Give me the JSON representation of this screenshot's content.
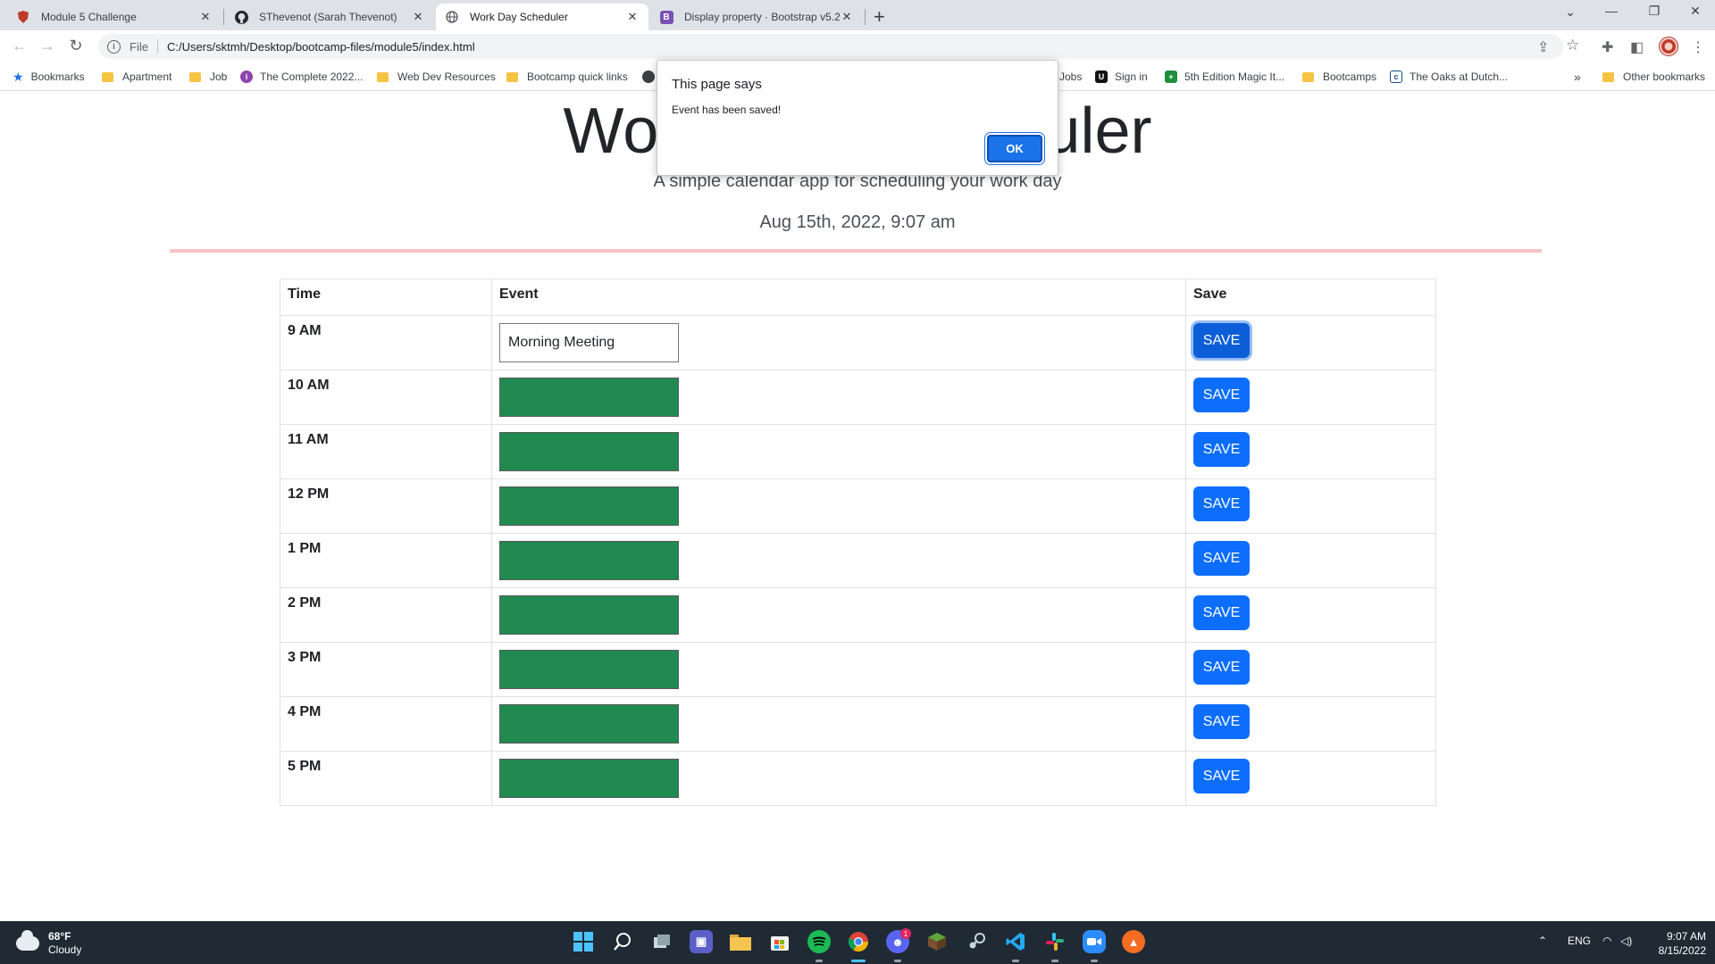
{
  "browser": {
    "tabs": [
      {
        "title": "Module 5 Challenge",
        "icon": "shield-favicon"
      },
      {
        "title": "SThevenot (Sarah Thevenot)",
        "icon": "github-favicon"
      },
      {
        "title": "Work Day Scheduler",
        "icon": "globe-favicon",
        "active": true
      },
      {
        "title": "Display property · Bootstrap v5.2",
        "icon": "bootstrap-favicon"
      }
    ],
    "address": {
      "scheme_label": "File",
      "url": "C:/Users/sktmh/Desktop/bootcamp-files/module5/index.html"
    },
    "bookmarks": [
      "Bookmarks",
      "Apartment",
      "Job",
      "The Complete 2022...",
      "Web Dev Resources",
      "Bootcamp quick links",
      "Jobs",
      "Sign in",
      "5th Edition Magic It...",
      "Bootcamps",
      "The Oaks at Dutch...",
      "Other bookmarks"
    ],
    "bookmarks_overflow": "»"
  },
  "page": {
    "title": "Work Day Scheduler",
    "lead": "A simple calendar app for scheduling your work day",
    "current_day": "Aug 15th, 2022, 9:07 am",
    "table": {
      "headers": [
        "Time",
        "Event",
        "Save"
      ],
      "rows": [
        {
          "time": "9 AM",
          "event": "Morning Meeting",
          "state": "present",
          "save": "SAVE"
        },
        {
          "time": "10 AM",
          "event": "",
          "state": "future",
          "save": "SAVE"
        },
        {
          "time": "11 AM",
          "event": "",
          "state": "future",
          "save": "SAVE"
        },
        {
          "time": "12 PM",
          "event": "",
          "state": "future",
          "save": "SAVE"
        },
        {
          "time": "1 PM",
          "event": "",
          "state": "future",
          "save": "SAVE"
        },
        {
          "time": "2 PM",
          "event": "",
          "state": "future",
          "save": "SAVE"
        },
        {
          "time": "3 PM",
          "event": "",
          "state": "future",
          "save": "SAVE"
        },
        {
          "time": "4 PM",
          "event": "",
          "state": "future",
          "save": "SAVE"
        },
        {
          "time": "5 PM",
          "event": "",
          "state": "future",
          "save": "SAVE"
        }
      ]
    },
    "colors": {
      "future": "#218a51",
      "present": "#ffffff",
      "save": "#0d6efd",
      "divider": "#f8c4c4"
    }
  },
  "dialog": {
    "title": "This page says",
    "message": "Event has been saved!",
    "ok_label": "OK"
  },
  "taskbar": {
    "weather_temp": "68°F",
    "weather_cond": "Cloudy",
    "lang": "ENG",
    "time": "9:07 AM",
    "date": "8/15/2022",
    "discord_badge": "1"
  }
}
